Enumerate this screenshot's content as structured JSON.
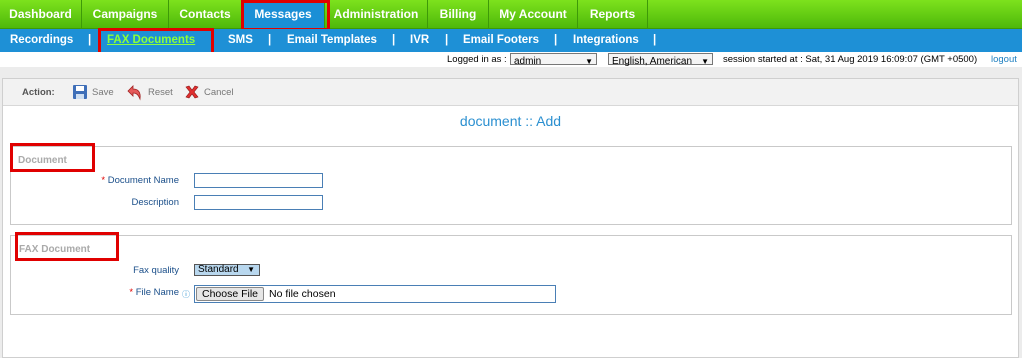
{
  "top_nav": {
    "items": [
      {
        "label": "Dashboard"
      },
      {
        "label": "Campaigns"
      },
      {
        "label": "Contacts"
      },
      {
        "label": "Messages"
      },
      {
        "label": "Administration"
      },
      {
        "label": "Billing"
      },
      {
        "label": "My Account"
      },
      {
        "label": "Reports"
      }
    ],
    "active": "Messages"
  },
  "sub_nav": {
    "items": [
      {
        "label": "Recordings"
      },
      {
        "label": "FAX Documents"
      },
      {
        "label": "SMS"
      },
      {
        "label": "Email Templates"
      },
      {
        "label": "IVR"
      },
      {
        "label": "Email Footers"
      },
      {
        "label": "Integrations"
      }
    ],
    "separator": "|",
    "active": "FAX Documents"
  },
  "session": {
    "logged_in_label": "Logged in as :",
    "user": "admin",
    "language": "English, American",
    "session_text": "session started at : Sat, 31 Aug 2019 16:09:07 (GMT +0500)",
    "logout": "logout"
  },
  "actions": {
    "label": "Action:",
    "save": "Save",
    "reset": "Reset",
    "cancel": "Cancel"
  },
  "form": {
    "title": "document :: Add",
    "document_section": {
      "legend": "Document",
      "name_label": "Document Name",
      "name_value": "",
      "description_label": "Description",
      "description_value": ""
    },
    "fax_section": {
      "legend": "FAX Document",
      "quality_label": "Fax quality",
      "quality_value": "Standard",
      "file_label": "File Name",
      "file_button": "Choose File",
      "file_status": "No file chosen"
    },
    "required_marker": "*"
  },
  "colors": {
    "top_nav_green": "#5ecb12",
    "active_blue": "#1a8fd6",
    "highlight_red": "#e00000",
    "link_blue": "#2a8fd0"
  }
}
